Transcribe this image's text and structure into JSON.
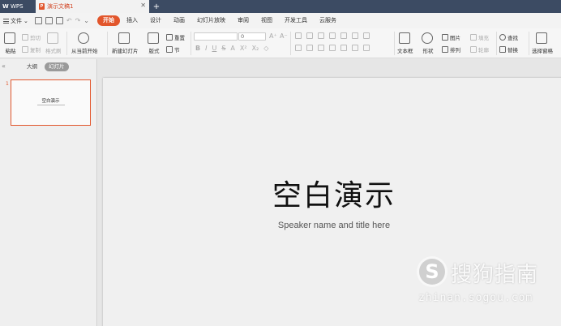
{
  "titlebar": {
    "app_name": "WPS",
    "doc_tab": "演示文稿1",
    "new_tab": "+"
  },
  "menubar": {
    "file": "文件",
    "tabs": [
      "开始",
      "插入",
      "设计",
      "动画",
      "幻灯片放映",
      "审阅",
      "视图",
      "开发工具",
      "云服务"
    ],
    "active_tab": "开始"
  },
  "ribbon": {
    "paste": "粘贴",
    "cut": "剪切",
    "copy": "复制",
    "format_painter": "格式刷",
    "play_from_current": "从当前开始",
    "new_slide": "新建幻灯片",
    "layout": "版式",
    "reset": "重置",
    "section": "节",
    "font_size": "0",
    "textbox": "文本框",
    "shape": "形状",
    "picture": "图片",
    "arrange": "排列",
    "fill": "填充",
    "outline": "轮廓",
    "find": "查找",
    "replace": "替换",
    "select_pane": "选择窗格",
    "font_buttons": [
      "B",
      "I",
      "U",
      "S",
      "A",
      "X²",
      "X₂"
    ]
  },
  "leftpanel": {
    "tab_outline": "大纲",
    "tab_slides": "幻灯片",
    "slide_number": "1",
    "thumb_title": "空白演示"
  },
  "slide": {
    "title": "空白演示",
    "subtitle": "Speaker name and title here"
  },
  "watermark": {
    "logo_letter": "S",
    "name": "搜狗指南",
    "url": "zhinan.sogou.com"
  },
  "colors": {
    "titlebar_bg": "#3c4b63",
    "accent": "#e2562c"
  }
}
